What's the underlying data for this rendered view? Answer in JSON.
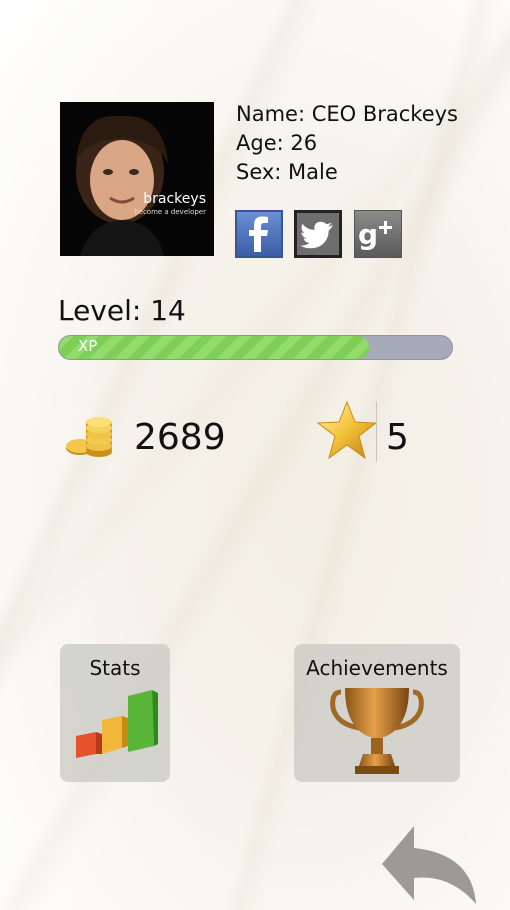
{
  "profile": {
    "avatar_brand": "brackeys",
    "avatar_tagline": "become a developer",
    "name_line": "Name: CEO Brackeys",
    "age_line": "Age: 26",
    "sex_line": "Sex: Male"
  },
  "social": [
    {
      "icon": "facebook-icon"
    },
    {
      "icon": "twitter-icon"
    },
    {
      "icon": "google-plus-icon"
    }
  ],
  "level": {
    "label": "Level: 14",
    "xp_label": "XP",
    "xp_fraction": 0.79
  },
  "currency": {
    "coins": "2689",
    "stars": "5"
  },
  "menu": {
    "stats_label": "Stats",
    "achievements_label": "Achievements"
  },
  "colors": {
    "xp_fill": "#7fce55",
    "xp_track": "#a6aab9",
    "tile_bg": "#c8c8c3"
  }
}
